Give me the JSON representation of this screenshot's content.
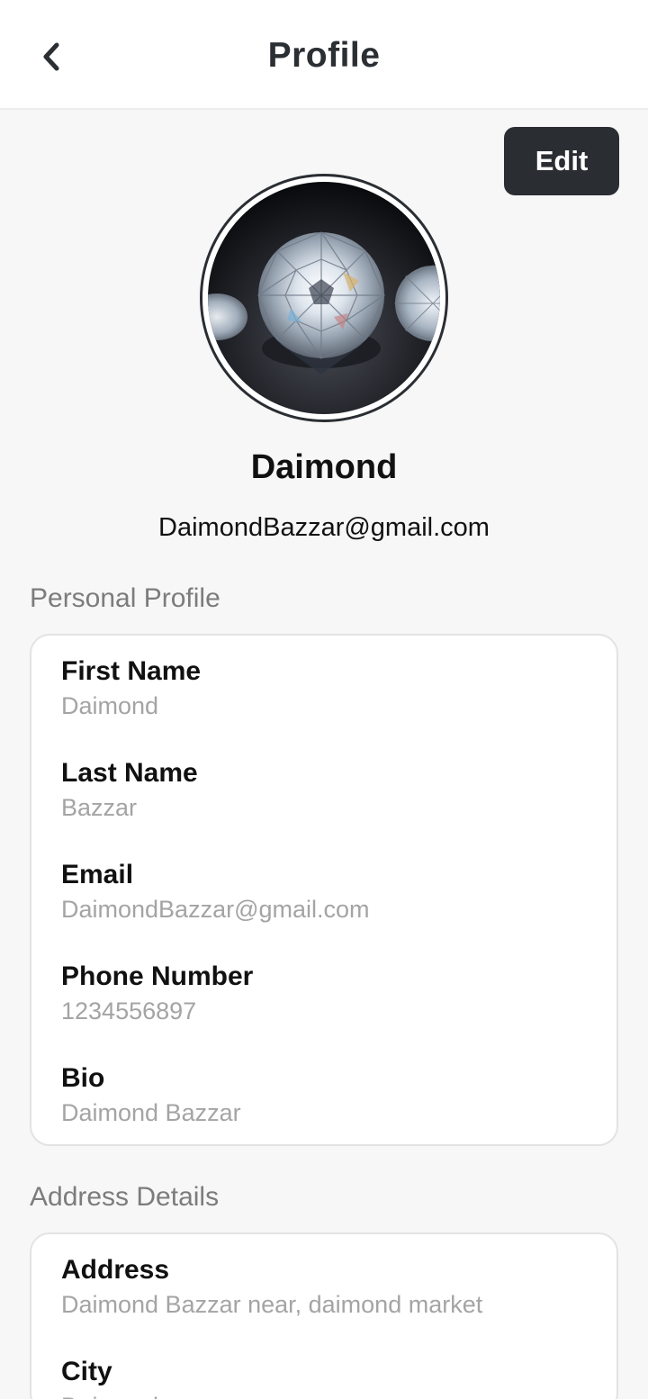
{
  "header": {
    "title": "Profile",
    "back_icon": "chevron-left-icon"
  },
  "actions": {
    "edit_label": "Edit"
  },
  "profile": {
    "avatar_alt": "diamond-photo",
    "name": "Daimond",
    "email": "DaimondBazzar@gmail.com"
  },
  "personal": {
    "heading": "Personal Profile",
    "fields": [
      {
        "label": "First Name",
        "value": "Daimond"
      },
      {
        "label": "Last Name",
        "value": "Bazzar"
      },
      {
        "label": "Email",
        "value": "DaimondBazzar@gmail.com"
      },
      {
        "label": "Phone Number",
        "value": "1234556897"
      },
      {
        "label": "Bio",
        "value": "Daimond Bazzar"
      }
    ]
  },
  "address": {
    "heading": "Address Details",
    "fields": [
      {
        "label": "Address",
        "value": "Daimond Bazzar near, daimond market"
      },
      {
        "label": "City",
        "value": "Daimond"
      }
    ]
  },
  "colors": {
    "primary_dark": "#2a2e33",
    "label_text": "#111111",
    "muted_text": "#a4a4a4",
    "section_heading": "#7c7c7c",
    "background": "#f7f7f7"
  }
}
